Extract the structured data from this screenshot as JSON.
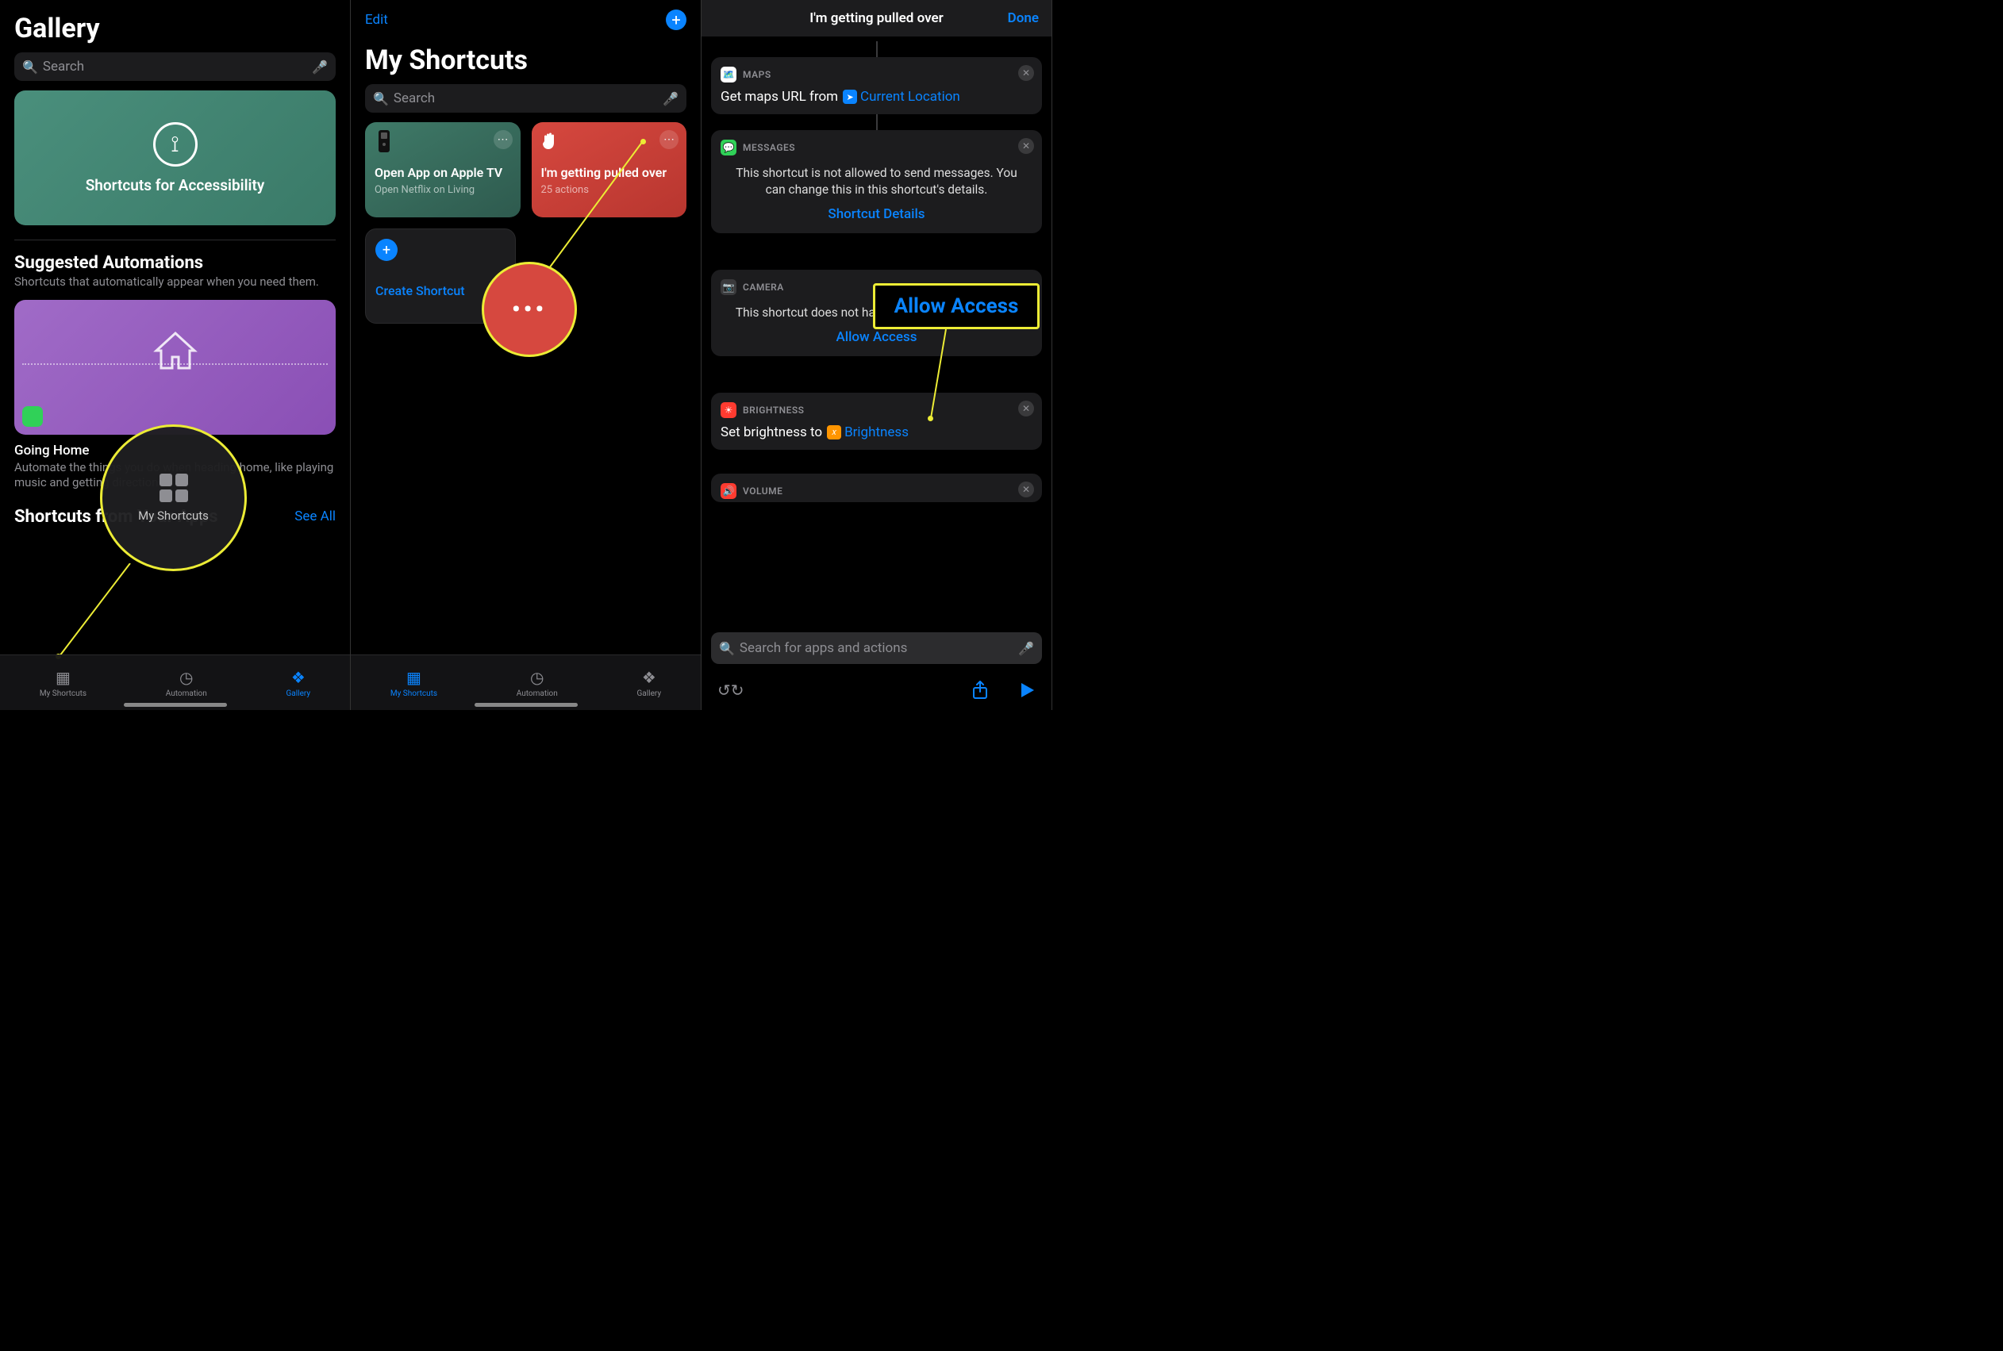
{
  "panel1": {
    "title": "Gallery",
    "search_placeholder": "Search",
    "banner_label": "Shortcuts for Accessibility",
    "suggested_heading": "Suggested Automations",
    "suggested_sub": "Shortcuts that automatically appear when you need them.",
    "going_home_label": "Going Home",
    "going_home_desc": "Automate the things you do when heading home, like playing music and getting directions.",
    "apps_heading": "Shortcuts from Your Apps",
    "see_all": "See All",
    "magnifier_label": "My Shortcuts",
    "tabs": {
      "my_shortcuts": "My Shortcuts",
      "automation": "Automation",
      "gallery": "Gallery"
    }
  },
  "panel2": {
    "edit": "Edit",
    "title": "My Shortcuts",
    "search_placeholder": "Search",
    "tile_green_title": "Open App on Apple TV",
    "tile_green_sub": "Open Netflix on Living",
    "tile_red_title": "I'm getting pulled over",
    "tile_red_sub": "25 actions",
    "create_label": "Create Shortcut",
    "tabs": {
      "my_shortcuts": "My Shortcuts",
      "automation": "Automation",
      "gallery": "Gallery"
    }
  },
  "panel3": {
    "header_title": "I'm getting pulled over",
    "done": "Done",
    "maps": {
      "name": "MAPS",
      "body_prefix": "Get maps URL from",
      "token": "Current Location"
    },
    "messages": {
      "name": "MESSAGES",
      "msg": "This shortcut is not allowed to send messages. You can change this in this shortcut's details.",
      "link": "Shortcut Details"
    },
    "camera": {
      "name": "CAMERA",
      "msg": "This shortcut does not have access to your camera.",
      "link": "Allow Access"
    },
    "brightness": {
      "name": "BRIGHTNESS",
      "body_prefix": "Set brightness to",
      "token": "Brightness"
    },
    "volume": {
      "name": "VOLUME"
    },
    "highlight_label": "Allow Access",
    "search_placeholder": "Search for apps and actions"
  }
}
